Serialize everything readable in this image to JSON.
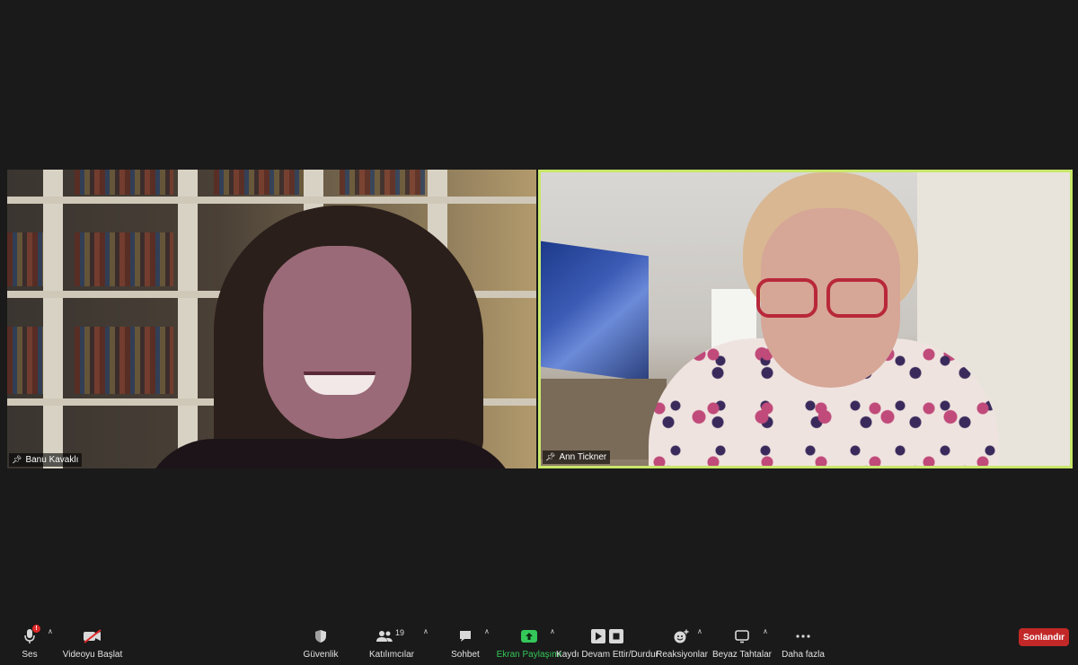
{
  "participants": [
    {
      "name": "Banu Kavaklı"
    },
    {
      "name": "Ann Tickner"
    }
  ],
  "toolbar": {
    "audio_label": "Ses",
    "audio_alert": "!",
    "video_label": "Videoyu Başlat",
    "security_label": "Güvenlik",
    "participants_label": "Katılımcılar",
    "participants_count": "19",
    "chat_label": "Sohbet",
    "share_label": "Ekran Paylaşımı",
    "record_label": "Kaydı Devam Ettir/Durdur",
    "reactions_label": "Reaksiyonlar",
    "whiteboard_label": "Beyaz Tahtalar",
    "more_label": "Daha fazla",
    "end_label": "Sonlandır"
  },
  "colors": {
    "active_speaker_border": "#c8e66a",
    "share_accent": "#34c759",
    "end_button": "#c22828"
  }
}
